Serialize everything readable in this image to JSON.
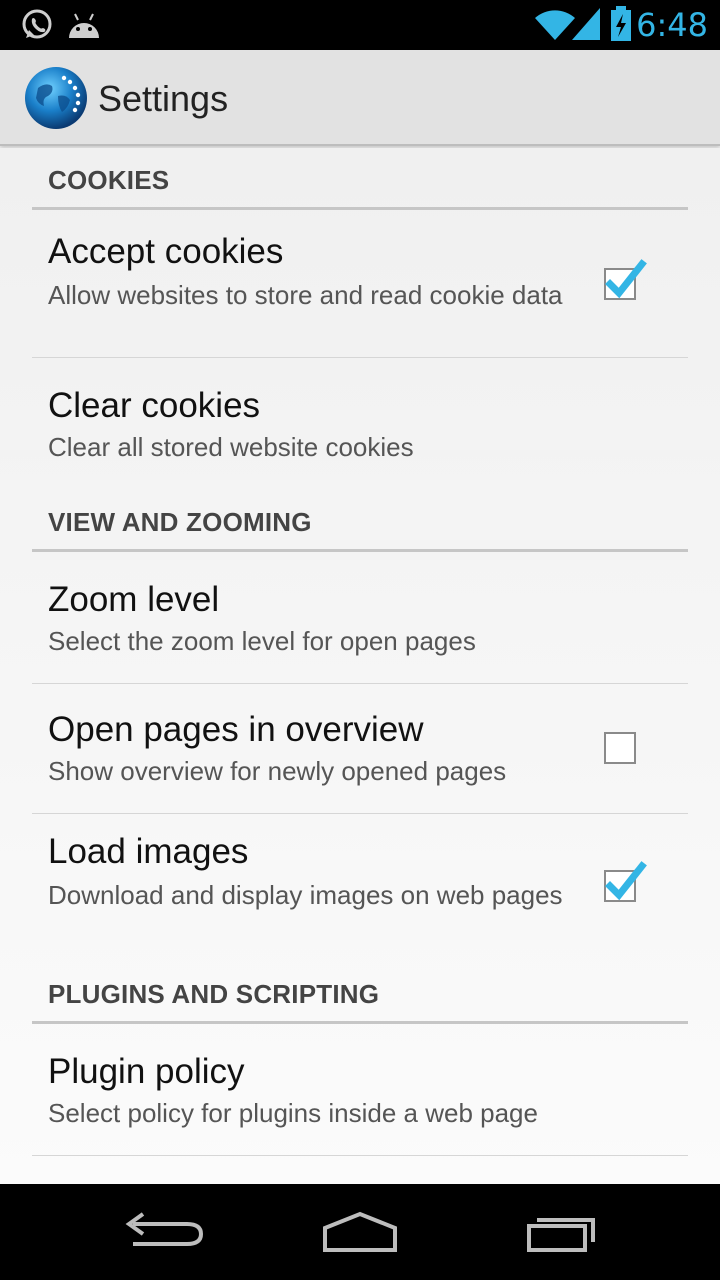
{
  "status_bar": {
    "time": "6:48",
    "left_icons": [
      "whatsapp-icon",
      "android-icon"
    ],
    "right_icons": [
      "wifi-icon",
      "signal-icon",
      "battery-charging-icon"
    ],
    "accent_color": "#33b5e5"
  },
  "action_bar": {
    "title": "Settings",
    "logo_icon": "globe-icon"
  },
  "sections": [
    {
      "title": "COOKIES",
      "items": [
        {
          "title": "Accept cookies",
          "summary": "Allow websites to store and read cookie data",
          "checkbox": true,
          "checked": true
        },
        {
          "title": "Clear cookies",
          "summary": "Clear all stored website cookies",
          "checkbox": false
        }
      ]
    },
    {
      "title": "VIEW AND ZOOMING",
      "items": [
        {
          "title": "Zoom level",
          "summary": "Select the zoom level for open pages",
          "checkbox": false
        },
        {
          "title": "Open pages in overview",
          "summary": "Show overview for newly opened pages",
          "checkbox": true,
          "checked": false
        },
        {
          "title": "Load images",
          "summary": "Download and display images on web pages",
          "checkbox": true,
          "checked": true
        }
      ]
    },
    {
      "title": "PLUGINS AND SCRIPTING",
      "items": [
        {
          "title": "Plugin policy",
          "summary": "Select policy for plugins inside a web page",
          "checkbox": false
        }
      ]
    }
  ],
  "nav_bar": {
    "buttons": [
      "back-icon",
      "home-icon",
      "recent-apps-icon"
    ]
  },
  "colors": {
    "check_mark": "#33b5e5",
    "category_text": "#444444",
    "title_text": "#111111",
    "summary_text": "#555555"
  }
}
